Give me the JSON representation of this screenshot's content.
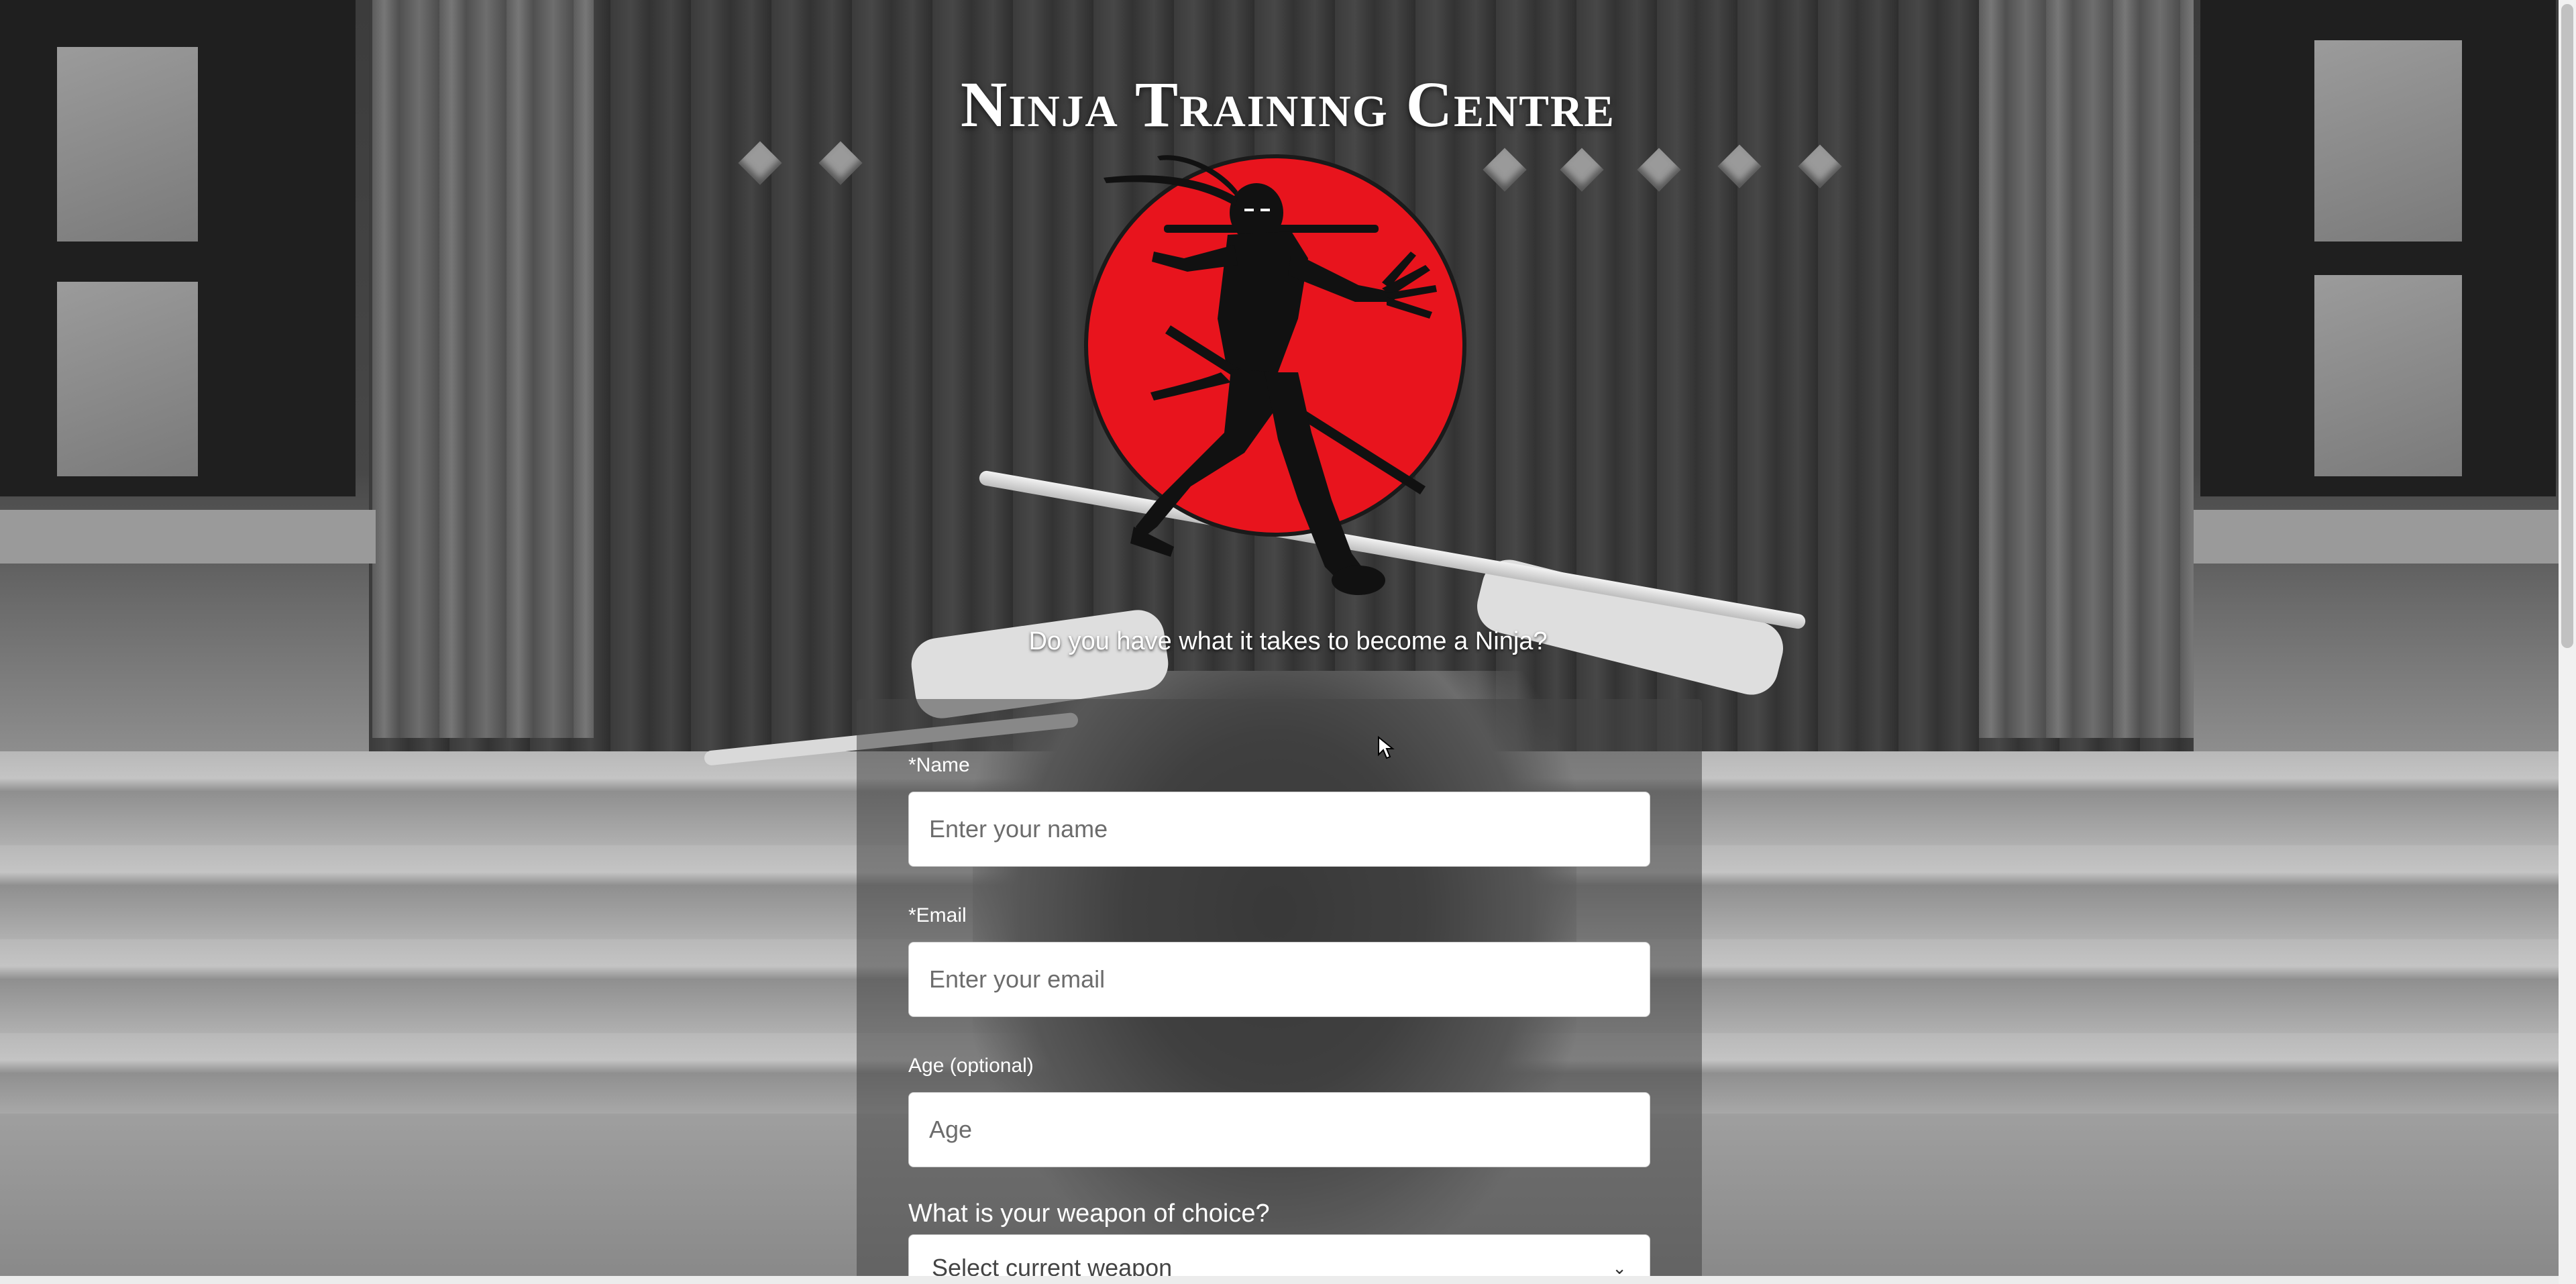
{
  "header": {
    "title": "Ninja Training Centre",
    "tagline": "Do you have what it takes to become a Ninja?"
  },
  "logo": {
    "icon": "ninja-on-red-sun-icon",
    "sun_color": "#e8141d",
    "silhouette_color": "#111111"
  },
  "form": {
    "name": {
      "label": "*Name",
      "placeholder": "Enter your name",
      "value": ""
    },
    "email": {
      "label": "*Email",
      "placeholder": "Enter your email",
      "value": ""
    },
    "age": {
      "label": "Age (optional)",
      "placeholder": "Age",
      "value": ""
    },
    "weapon": {
      "label": "What is your weapon of choice?",
      "selected": "Select current weapon"
    }
  },
  "colors": {
    "text": "#ffffff",
    "panel": "rgba(70,70,70,0.55)",
    "input_bg": "#ffffff"
  }
}
